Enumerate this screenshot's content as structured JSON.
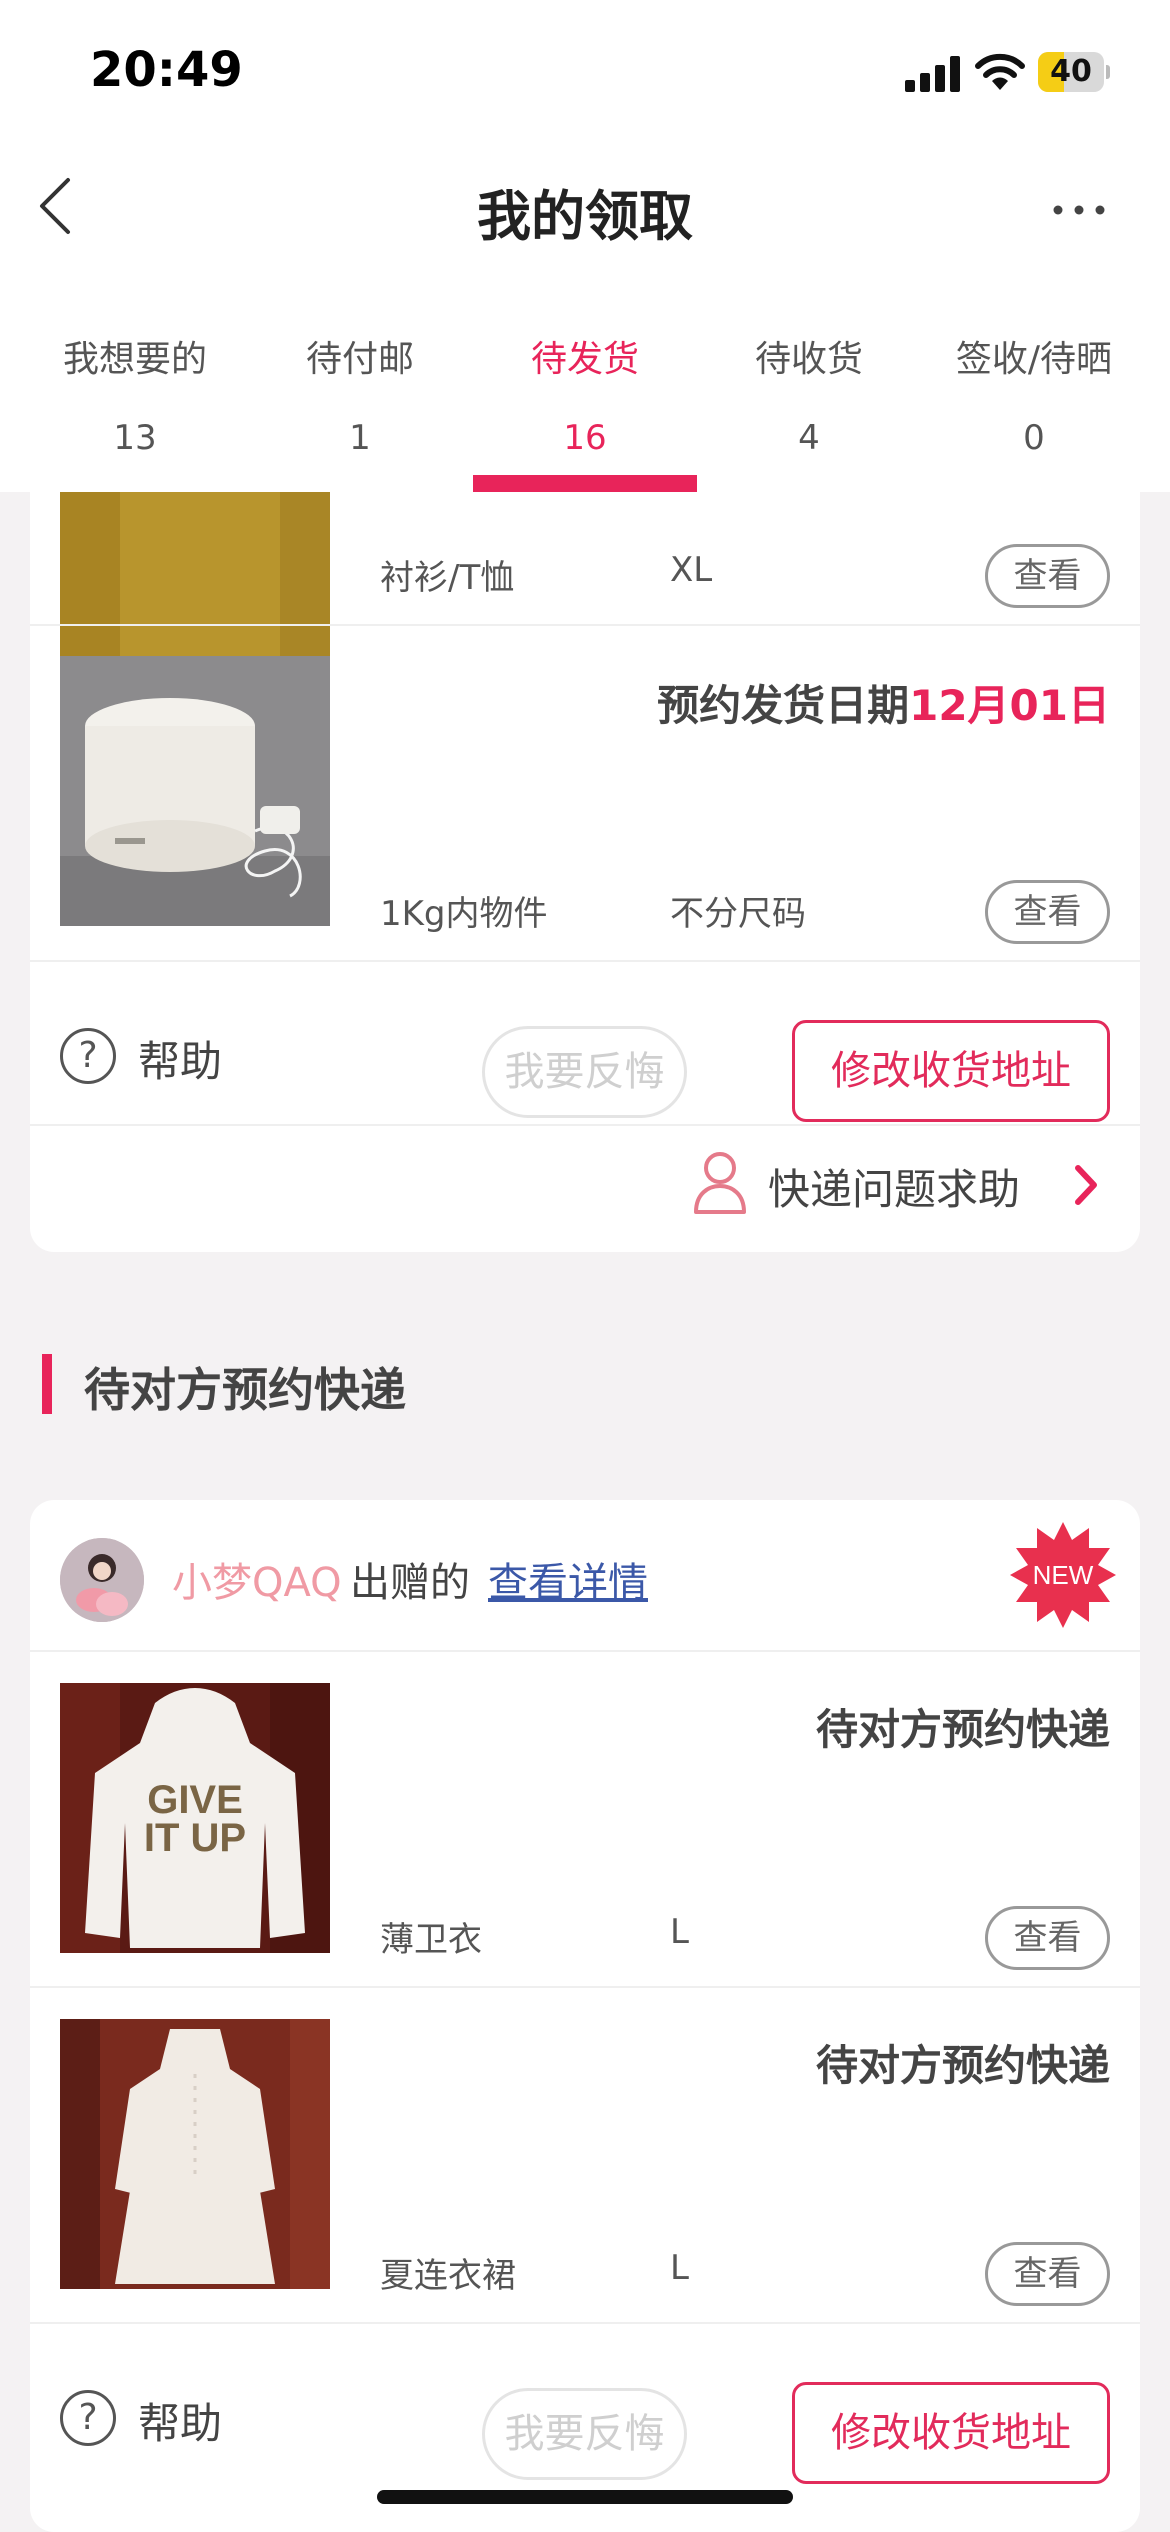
{
  "status_bar": {
    "time": "20:49",
    "battery": "40",
    "battery_level": 0.4,
    "battery_color": "#f5cd15"
  },
  "nav": {
    "title": "我的领取",
    "back_icon": "chevron-left-icon",
    "more_icon": "more-dots-icon"
  },
  "tabs": [
    {
      "label": "我想要的",
      "count": "13"
    },
    {
      "label": "待付邮",
      "count": "1"
    },
    {
      "label": "待发货",
      "count": "16",
      "active": true
    },
    {
      "label": "待收货",
      "count": "4"
    },
    {
      "label": "签收/待晒",
      "count": "0"
    }
  ],
  "accent_color": "#e8245a",
  "order1": {
    "items": [
      {
        "category": "衬衫/T恤",
        "size": "XL",
        "view": "查看"
      },
      {
        "title_prefix": "预约发货日期",
        "title_date": "12月01日",
        "category": "1Kg内物件",
        "size": "不分尺码",
        "view": "查看"
      }
    ],
    "help": "帮助",
    "regret": "我要反悔",
    "address": "修改收货地址",
    "express_help": "快递问题求助"
  },
  "section": {
    "title": "待对方预约快递"
  },
  "order2": {
    "giver_name": "小梦QAQ",
    "giver_action": "出赠的",
    "detail_link": "查看详情",
    "badge": "NEW",
    "items": [
      {
        "title": "待对方预约快递",
        "category": "薄卫衣",
        "size": "L",
        "view": "查看"
      },
      {
        "title": "待对方预约快递",
        "category": "夏连衣裙",
        "size": "L",
        "view": "查看"
      }
    ],
    "help": "帮助",
    "regret": "我要反悔",
    "address": "修改收货地址"
  }
}
